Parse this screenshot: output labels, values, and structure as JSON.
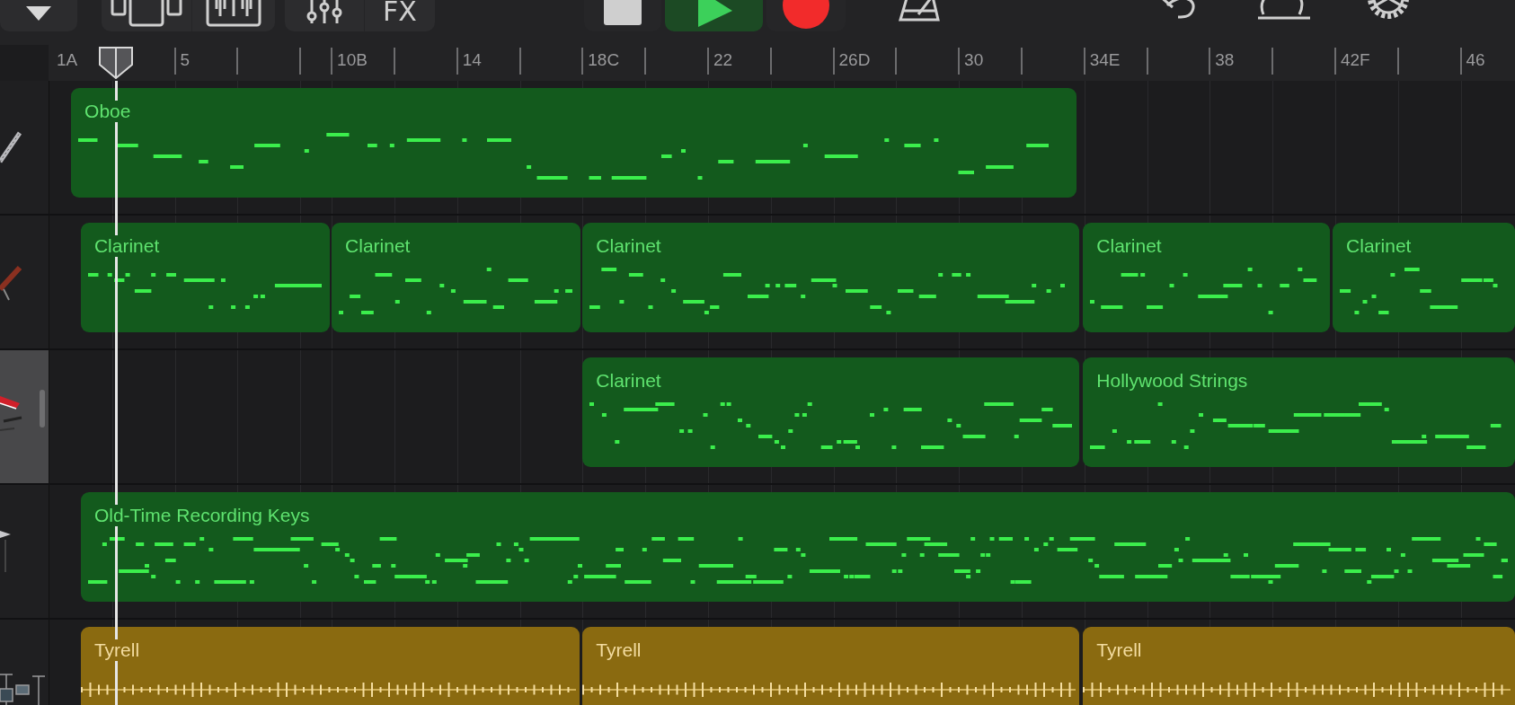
{
  "toolbar": {
    "fx_label": "FX",
    "transport": [
      {
        "kind": "stop",
        "on": false
      },
      {
        "kind": "play",
        "on": true
      },
      {
        "kind": "record",
        "on": false
      }
    ]
  },
  "ruler": {
    "labels": [
      "1A",
      "5",
      "10B",
      "14",
      "18C",
      "22",
      "26D",
      "30",
      "34E",
      "38",
      "42F",
      "46"
    ]
  },
  "tracks": [
    {
      "selected": false,
      "regions": [
        {
          "name": "Oboe",
          "kind": "midi"
        }
      ]
    },
    {
      "selected": false,
      "regions": [
        {
          "name": "Clarinet",
          "kind": "midi"
        },
        {
          "name": "Clarinet",
          "kind": "midi"
        },
        {
          "name": "Clarinet",
          "kind": "midi"
        },
        {
          "name": "Clarinet",
          "kind": "midi"
        },
        {
          "name": "Clarinet",
          "kind": "midi"
        }
      ]
    },
    {
      "selected": true,
      "regions": [
        {
          "name": "Clarinet",
          "kind": "midi"
        },
        {
          "name": "Hollywood Strings",
          "kind": "midi"
        }
      ]
    },
    {
      "selected": false,
      "regions": [
        {
          "name": "Old-Time Recording Keys",
          "kind": "midi"
        }
      ]
    },
    {
      "selected": false,
      "regions": [
        {
          "name": "Tyrell",
          "kind": "drummer"
        },
        {
          "name": "Tyrell",
          "kind": "drummer"
        },
        {
          "name": "Tyrell",
          "kind": "drummer"
        }
      ]
    }
  ]
}
